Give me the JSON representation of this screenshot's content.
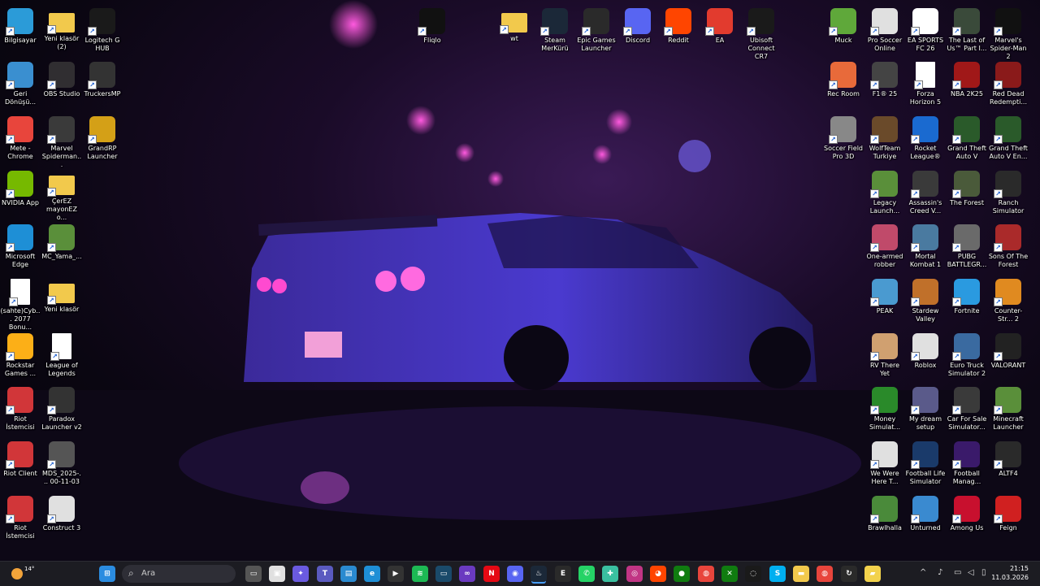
{
  "weather": {
    "temperature": "14°"
  },
  "search": {
    "placeholder": "Ara"
  },
  "clock": {
    "time": "21:15",
    "date": "11.03.2026"
  },
  "desktop_icons": [
    {
      "label": "Bilgisayar",
      "icon": "computer-icon",
      "color": "#2b9bd8"
    },
    {
      "label": "Yeni klasör (2)",
      "icon": "folder-icon",
      "color": "#f2c94c"
    },
    {
      "label": "Logitech G HUB",
      "icon": "logitech-icon",
      "color": "#1a1a1a"
    },
    {
      "label": "Geri Dönüşü...",
      "icon": "recycle-bin-icon",
      "color": "#3a8fd0"
    },
    {
      "label": "OBS Studio",
      "icon": "obs-icon",
      "color": "#302e31"
    },
    {
      "label": "TruckersMP",
      "icon": "truckersmp-icon",
      "color": "#333333"
    },
    {
      "label": "Mete - Chrome",
      "icon": "chrome-icon",
      "color": "#e8453c"
    },
    {
      "label": "Marvel Spiderman...",
      "icon": "spiderman-icon",
      "color": "#3a3a3a"
    },
    {
      "label": "GrandRP Launcher",
      "icon": "grandrp-icon",
      "color": "#d4a017"
    },
    {
      "label": "NVIDIA App",
      "icon": "nvidia-icon",
      "color": "#76b900"
    },
    {
      "label": "ÇerEZ mayonEZ o...",
      "icon": "folder-icon",
      "color": "#f2c94c"
    },
    {
      "label": "Microsoft Edge",
      "icon": "edge-icon",
      "color": "#1e8fd6"
    },
    {
      "label": "MC_Yama_...",
      "icon": "mc-yama-icon",
      "color": "#5a8f3a"
    },
    {
      "label": "(sahte)Cyb... 2077 Bonu...",
      "icon": "file-icon",
      "color": "#ffffff"
    },
    {
      "label": "Yeni klasör",
      "icon": "folder-icon",
      "color": "#f2c94c"
    },
    {
      "label": "Rockstar Games ...",
      "icon": "rockstar-icon",
      "color": "#fcaf17"
    },
    {
      "label": "League of Legends",
      "icon": "file-icon",
      "color": "#ffffff"
    },
    {
      "label": "Riot İstemcisi",
      "icon": "riot-icon",
      "color": "#d13639"
    },
    {
      "label": "Paradox Launcher v2",
      "icon": "paradox-icon",
      "color": "#333333"
    },
    {
      "label": "Riot Client",
      "icon": "riot-icon",
      "color": "#d13639"
    },
    {
      "label": "MDS_2025-... 00-11-03",
      "icon": "image-icon",
      "color": "#555555"
    },
    {
      "label": "Riot İstemcisi",
      "icon": "riot-icon",
      "color": "#d13639"
    },
    {
      "label": "Construct 3",
      "icon": "construct-icon",
      "color": "#e0e0e0"
    },
    {
      "label": "Fliqlo",
      "icon": "fliqlo-icon",
      "color": "#111111"
    },
    {
      "label": "wt",
      "icon": "folder-icon",
      "color": "#f2c94c"
    },
    {
      "label": "Steam MerKürü",
      "icon": "steam-icon",
      "color": "#1b2838"
    },
    {
      "label": "Epic Games Launcher",
      "icon": "epic-icon",
      "color": "#2a2a2a"
    },
    {
      "label": "Discord",
      "icon": "discord-icon",
      "color": "#5865f2"
    },
    {
      "label": "Reddit",
      "icon": "reddit-icon",
      "color": "#ff4500"
    },
    {
      "label": "EA",
      "icon": "ea-icon",
      "color": "#e23b2e"
    },
    {
      "label": "Ubisoft Connect CR7",
      "icon": "ubisoft-icon",
      "color": "#1a1a1a"
    },
    {
      "label": "Muck",
      "icon": "muck-icon",
      "color": "#5fa83a"
    },
    {
      "label": "Pro Soccer Online",
      "icon": "pro-soccer-icon",
      "color": "#e0e0e0"
    },
    {
      "label": "EA SPORTS FC 26",
      "icon": "ea-fc-icon",
      "color": "#ffffff"
    },
    {
      "label": "The Last of Us™ Part I...",
      "icon": "last-of-us-icon",
      "color": "#3a4a3a"
    },
    {
      "label": "Marvel's Spider-Man 2",
      "icon": "spiderman2-icon",
      "color": "#111111"
    },
    {
      "label": "Rec Room",
      "icon": "rec-room-icon",
      "color": "#e86a3a"
    },
    {
      "label": "F1® 25",
      "icon": "f1-icon",
      "color": "#444444"
    },
    {
      "label": "Forza Horizon 5",
      "icon": "file-icon",
      "color": "#ffffff"
    },
    {
      "label": "NBA 2K25",
      "icon": "nba2k-icon",
      "color": "#a01818"
    },
    {
      "label": "Red Dead Redempti...",
      "icon": "rdr-icon",
      "color": "#8a1a1a"
    },
    {
      "label": "Soccer Field Pro 3D",
      "icon": "soccer-field-icon",
      "color": "#888888"
    },
    {
      "label": "WolfTeam Turkiye",
      "icon": "wolfteam-icon",
      "color": "#6a4a2a"
    },
    {
      "label": "Rocket League®",
      "icon": "rocket-league-icon",
      "color": "#1a6ad0"
    },
    {
      "label": "Grand Theft Auto V",
      "icon": "gta-icon",
      "color": "#2a5a2a"
    },
    {
      "label": "Grand Theft Auto V En...",
      "icon": "gta-icon",
      "color": "#2a5a2a"
    },
    {
      "label": "Legacy Launch...",
      "icon": "minecraft-icon",
      "color": "#5a8f3a"
    },
    {
      "label": "Assassin's Creed V...",
      "icon": "assassins-creed-icon",
      "color": "#3a3a3a"
    },
    {
      "label": "The Forest",
      "icon": "the-forest-icon",
      "color": "#4a5a3a"
    },
    {
      "label": "Ranch Simulator",
      "icon": "ranch-icon",
      "color": "#2a2a2a"
    },
    {
      "label": "One-armed robber",
      "icon": "oar-icon",
      "color": "#c04a6a"
    },
    {
      "label": "Mortal Kombat 1",
      "icon": "mortal-kombat-icon",
      "color": "#4a7aa0"
    },
    {
      "label": "PUBG BATTLEGR...",
      "icon": "pubg-icon",
      "color": "#6a6a6a"
    },
    {
      "label": "Sons Of The Forest",
      "icon": "sons-forest-icon",
      "color": "#aa2a2a"
    },
    {
      "label": "PEAK",
      "icon": "peak-icon",
      "color": "#4a9ad0"
    },
    {
      "label": "Stardew Valley",
      "icon": "stardew-icon",
      "color": "#c0702a"
    },
    {
      "label": "Fortnite",
      "icon": "fortnite-icon",
      "color": "#2a9ae0"
    },
    {
      "label": "Counter-Str... 2",
      "icon": "cs2-icon",
      "color": "#e08a20"
    },
    {
      "label": "RV There Yet",
      "icon": "rv-icon",
      "color": "#d0a070"
    },
    {
      "label": "Roblox",
      "icon": "roblox-icon",
      "color": "#e0e0e0"
    },
    {
      "label": "Euro Truck Simulator 2",
      "icon": "ets2-icon",
      "color": "#3a6aa0"
    },
    {
      "label": "VALORANT",
      "icon": "valorant-icon",
      "color": "#222222"
    },
    {
      "label": "Money Simulat...",
      "icon": "money-sim-icon",
      "color": "#2a8a2a"
    },
    {
      "label": "My dream setup",
      "icon": "dream-setup-icon",
      "color": "#5a5a8a"
    },
    {
      "label": "Car For Sale Simulator...",
      "icon": "car-sale-icon",
      "color": "#3a3a3a"
    },
    {
      "label": "Minecraft Launcher",
      "icon": "minecraft-icon",
      "color": "#5a8f3a"
    },
    {
      "label": "We Were Here T...",
      "icon": "we-were-here-icon",
      "color": "#e0e0e0"
    },
    {
      "label": "Football Life Simulator",
      "icon": "football-life-icon",
      "color": "#1a3a6a"
    },
    {
      "label": "Football Manag...",
      "icon": "football-manager-icon",
      "color": "#3a1a6a"
    },
    {
      "label": "ALTF4",
      "icon": "altf4-icon",
      "color": "#2a2a2a"
    },
    {
      "label": "Brawlhalla",
      "icon": "brawlhalla-icon",
      "color": "#4a8a3a"
    },
    {
      "label": "Unturned",
      "icon": "unturned-icon",
      "color": "#3a8ad0"
    },
    {
      "label": "Among Us",
      "icon": "among-us-icon",
      "color": "#c8102e"
    },
    {
      "label": "Feign",
      "icon": "feign-icon",
      "color": "#d02020"
    }
  ],
  "taskbar_apps": [
    {
      "icon": "start-icon",
      "color": "#2b8ce0",
      "glyph": "⊞"
    },
    {
      "icon": "task-view-icon",
      "color": "#555555",
      "glyph": "▭"
    },
    {
      "icon": "store-icon",
      "color": "#e0e0e0",
      "glyph": "▣"
    },
    {
      "icon": "copilot-icon",
      "color": "#6a5ae0",
      "glyph": "✦"
    },
    {
      "icon": "teams-icon",
      "color": "#5a5ac0",
      "glyph": "T"
    },
    {
      "icon": "remote-desktop-icon",
      "color": "#2a8ad0",
      "glyph": "▤"
    },
    {
      "icon": "edge-icon",
      "color": "#1e8fd6",
      "glyph": "e"
    },
    {
      "icon": "media-player-icon",
      "color": "#333333",
      "glyph": "▶"
    },
    {
      "icon": "spotify-icon",
      "color": "#1db954",
      "glyph": "≋"
    },
    {
      "icon": "terminal-icon",
      "color": "#1a4a6a",
      "glyph": "▭"
    },
    {
      "icon": "visual-studio-icon",
      "color": "#6a3ac0",
      "glyph": "∞"
    },
    {
      "icon": "netflix-icon",
      "color": "#e50914",
      "glyph": "N"
    },
    {
      "icon": "discord-icon",
      "color": "#5865f2",
      "glyph": "◉"
    },
    {
      "icon": "steam-icon",
      "color": "#1b2838",
      "glyph": "♨"
    },
    {
      "icon": "epic-icon",
      "color": "#2a2a2a",
      "glyph": "E"
    },
    {
      "icon": "whatsapp-icon",
      "color": "#25d366",
      "glyph": "✆"
    },
    {
      "icon": "gallery-icon",
      "color": "#3ac0a0",
      "glyph": "✚"
    },
    {
      "icon": "instagram-icon",
      "color": "#c13584",
      "glyph": "◎"
    },
    {
      "icon": "reddit-icon",
      "color": "#ff4500",
      "glyph": "◕"
    },
    {
      "icon": "xbox-app-icon",
      "color": "#107c10",
      "glyph": "●"
    },
    {
      "icon": "chrome-icon",
      "color": "#e8453c",
      "glyph": "◍"
    },
    {
      "icon": "xbox-icon",
      "color": "#107c10",
      "glyph": "✕"
    },
    {
      "icon": "ubisoft-icon",
      "color": "#1a1a1a",
      "glyph": "◌"
    },
    {
      "icon": "skype-icon",
      "color": "#00aff0",
      "glyph": "S"
    },
    {
      "icon": "file-explorer-icon",
      "color": "#f2c94c",
      "glyph": "▬"
    },
    {
      "icon": "chrome-profile-icon",
      "color": "#e8453c",
      "glyph": "◍"
    },
    {
      "icon": "steam-spin-icon",
      "color": "#2a2a2a",
      "glyph": "↻"
    },
    {
      "icon": "notes-icon",
      "color": "#f2d24c",
      "glyph": "▰"
    }
  ],
  "tray": [
    {
      "icon": "chevron-up-icon",
      "glyph": "^"
    },
    {
      "icon": "microphone-icon",
      "glyph": "♪"
    },
    {
      "icon": "network-icon",
      "glyph": "▭"
    },
    {
      "icon": "volume-icon",
      "glyph": "◁"
    },
    {
      "icon": "battery-icon",
      "glyph": "▯"
    }
  ]
}
